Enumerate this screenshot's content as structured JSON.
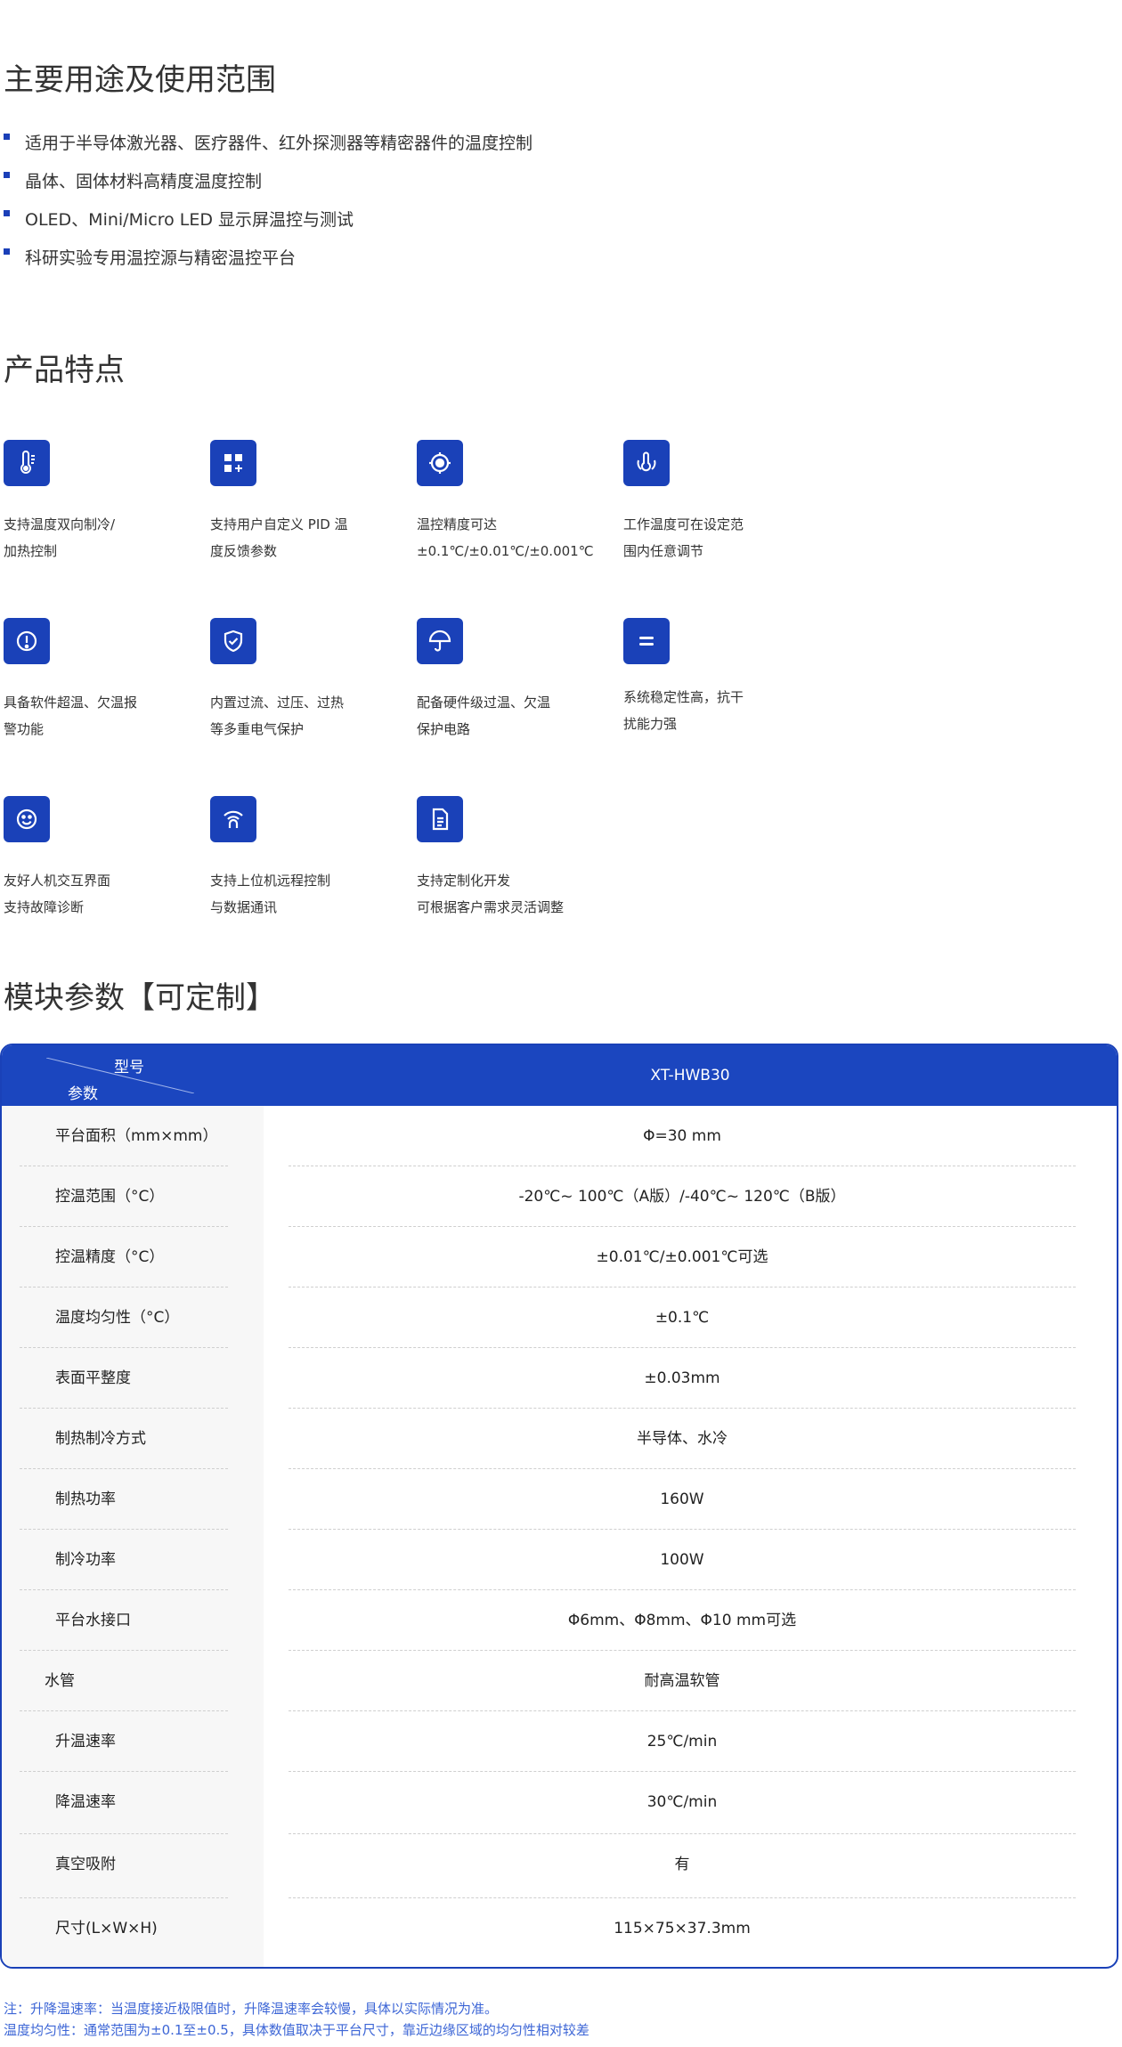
{
  "usage": {
    "title": "主要用途及使用范围",
    "items": [
      "适用于半导体激光器、医疗器件、红外探测器等精密器件的温度控制",
      "晶体、固体材料高精度温度控制",
      "OLED、Mini/Micro LED 显示屏温控与测试",
      "科研实验专用温控源与精密温控平台"
    ]
  },
  "features": {
    "title": "产品特点",
    "items": [
      {
        "icon": "thermometer-icon",
        "lines": [
          "支持温度双向制冷/",
          "加热控制"
        ]
      },
      {
        "icon": "grid-plus-icon",
        "lines": [
          "支持用户自定义 PID 温",
          "度反馈参数"
        ]
      },
      {
        "icon": "target-icon",
        "lines": [
          "温控精度可达",
          "±0.1℃/±0.01℃/±0.001℃"
        ]
      },
      {
        "icon": "adjust-temperature-icon",
        "lines": [
          "工作温度可在设定范",
          "围内任意调节"
        ]
      },
      {
        "icon": "alert-icon",
        "lines": [
          "具备软件超温、欠温报",
          "警功能"
        ]
      },
      {
        "icon": "shield-check-icon",
        "lines": [
          "内置过流、过压、过热",
          "等多重电气保护"
        ]
      },
      {
        "icon": "umbrella-icon",
        "lines": [
          "配备硬件级过温、欠温",
          "保护电路"
        ]
      },
      {
        "icon": "equals-icon",
        "lines": [
          "系统稳定性高，抗干",
          "扰能力强"
        ]
      },
      {
        "icon": "smiley-icon",
        "lines": [
          "友好人机交互界面",
          "支持故障诊断"
        ]
      },
      {
        "icon": "remote-signal-icon",
        "lines": [
          "支持上位机远程控制",
          "与数据通讯"
        ]
      },
      {
        "icon": "document-icon",
        "lines": [
          "支持定制化开发",
          "可根据客户需求灵活调整"
        ]
      }
    ],
    "icon_bg": "#1a41b8"
  },
  "params": {
    "title": "模块参数【可定制】",
    "header": {
      "model_label": "型号",
      "param_label": "参数",
      "product": "XT-HWB30"
    },
    "rows": [
      {
        "label": "平台面积（mm×mm）",
        "value": "Φ=30 mm"
      },
      {
        "label": "控温范围（°C）",
        "value": "-20℃~ 100℃（A版）/-40℃~ 120℃（B版）"
      },
      {
        "label": "控温精度（°C）",
        "value": "±0.01℃/±0.001℃可选"
      },
      {
        "label": "温度均匀性（°C）",
        "value": "±0.1℃"
      },
      {
        "label": "表面平整度",
        "value": "±0.03mm"
      },
      {
        "label": "制热制冷方式",
        "value": "半导体、水冷"
      },
      {
        "label": "制热功率",
        "value": "160W"
      },
      {
        "label": "制冷功率",
        "value": "100W"
      },
      {
        "label": "平台水接口",
        "value": "Φ6mm、Φ8mm、Φ10 mm可选"
      },
      {
        "label": "水管",
        "value": "耐高温软管"
      },
      {
        "label": "升温速率",
        "value": "25℃/min"
      },
      {
        "label": "降温速率",
        "value": "30℃/min"
      },
      {
        "label": "真空吸附",
        "value": "有"
      },
      {
        "label": "尺寸(L×W×H)",
        "value": "115×75×37.3mm"
      }
    ],
    "header_bg": "#1b46bf"
  },
  "notes": [
    "注：升降温速率：当温度接近极限值时，升降温速率会较慢，具体以实际情况为准。",
    "温度均匀性：通常范围为±0.1至±0.5，具体数值取决于平台尺寸，靠近边缘区域的均匀性相对较差"
  ],
  "colors": {
    "accent": "#1a41b8",
    "note": "#3d66d6"
  }
}
